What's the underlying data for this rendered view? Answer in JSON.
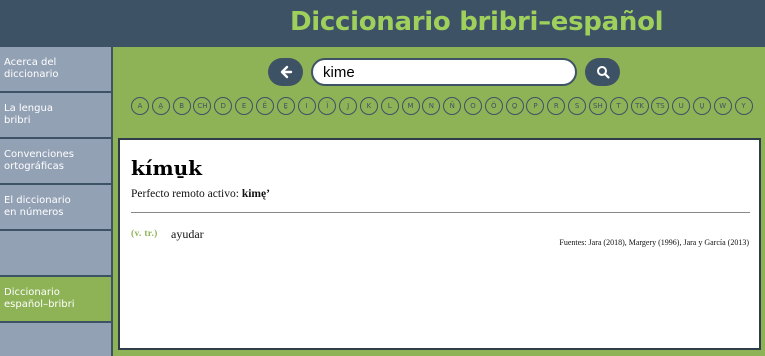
{
  "header": {
    "title": "Diccionario bribri–español"
  },
  "sidebar": {
    "items": [
      {
        "line1": "Acerca del",
        "line2": "diccionario"
      },
      {
        "line1": "La lengua",
        "line2": "bribri"
      },
      {
        "line1": "Convenciones",
        "line2": "ortográficas"
      },
      {
        "line1": "El diccionario",
        "line2": "en números"
      },
      {
        "line1": "",
        "line2": ""
      },
      {
        "line1": "Diccionario",
        "line2": "español–bribri"
      }
    ]
  },
  "search": {
    "value": "kime",
    "back_icon": "arrow-left-icon",
    "search_icon": "magnifier-icon"
  },
  "alphabet": [
    "A",
    "A̱",
    "B",
    "CH",
    "D",
    "E",
    "Ë",
    "E̱",
    "I",
    "Ï",
    "J",
    "K",
    "L",
    "M",
    "N",
    "Ñ",
    "O",
    "Ö",
    "O̱",
    "P",
    "R",
    "S",
    "SH",
    "T",
    "TK",
    "TS",
    "U",
    "U̱",
    "W",
    "Y"
  ],
  "entry": {
    "word": "kímu̱k",
    "note_prefix": "Perfecto remoto activo:",
    "note_form": "kimę’",
    "pos": "(v. tr.)",
    "definition": "ayudar",
    "sources": "Fuentes: Jara (2018), Margery (1996), Jara y García (2013)"
  },
  "colors": {
    "header_bg": "#3e5266",
    "accent": "#8db356",
    "title": "#9fd05c",
    "sidebar_bg": "#93a1b5"
  }
}
